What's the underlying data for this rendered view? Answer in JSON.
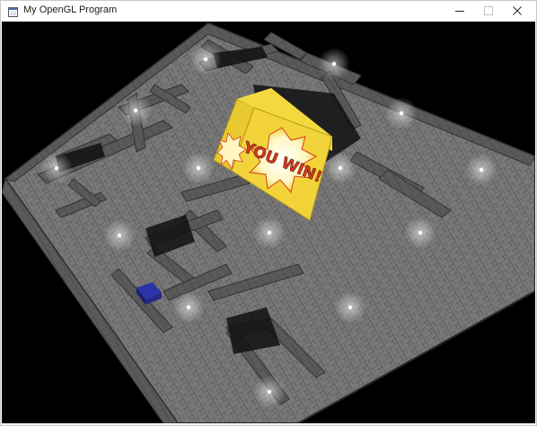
{
  "window": {
    "title": "My OpenGL Program",
    "controls": {
      "minimize_icon": "minimize-icon",
      "maximize_icon": "maximize-icon",
      "close_icon": "close-icon"
    }
  },
  "scene": {
    "win_texture_text": "YOU WIN!",
    "colors": {
      "background": "#000000",
      "floor": "#8a8a8a",
      "wall": "#595959",
      "lamp": "#ffffff",
      "goal_cube": "#f2d43a",
      "player_block": "#2a34a8"
    }
  }
}
